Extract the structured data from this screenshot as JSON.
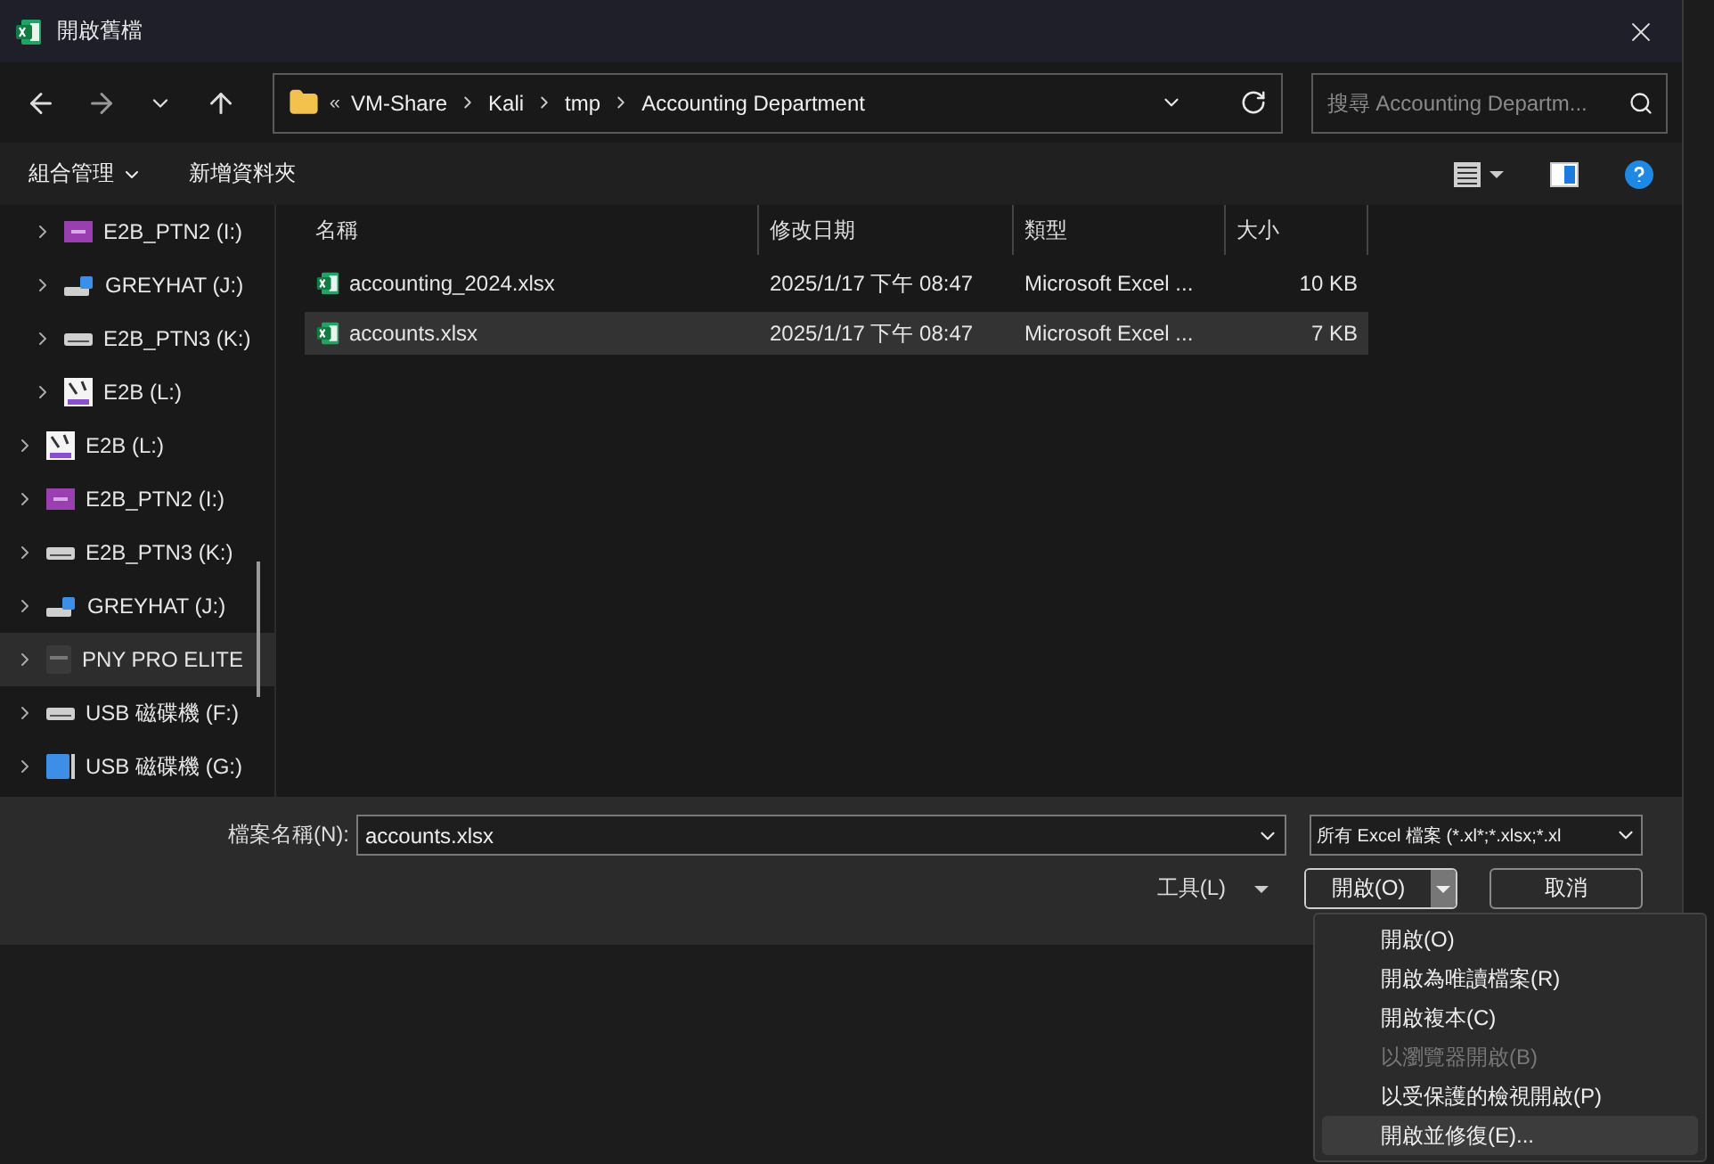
{
  "window": {
    "title": "開啟舊檔"
  },
  "address": {
    "overflow": "«",
    "crumbs": [
      "VM-Share",
      "Kali",
      "tmp",
      "Accounting Department"
    ]
  },
  "search": {
    "placeholder": "搜尋 Accounting Departm..."
  },
  "commands": {
    "organize": "組合管理",
    "new_folder": "新增資料夾"
  },
  "sidebar": {
    "child_items": [
      {
        "label": "E2B_PTN2 (I:)",
        "kind": "badge",
        "selected": false
      },
      {
        "label": "GREYHAT (J:)",
        "kind": "network",
        "selected": false
      },
      {
        "label": "E2B_PTN3 (K:)",
        "kind": "disk",
        "selected": false
      },
      {
        "label": "E2B (L:)",
        "kind": "tool",
        "selected": false
      }
    ],
    "items": [
      {
        "label": "E2B (L:)",
        "kind": "tool",
        "selected": false
      },
      {
        "label": "E2B_PTN2 (I:)",
        "kind": "badge",
        "selected": false
      },
      {
        "label": "E2B_PTN3 (K:)",
        "kind": "disk",
        "selected": false
      },
      {
        "label": "GREYHAT (J:)",
        "kind": "network",
        "selected": false
      },
      {
        "label": "PNY PRO ELITE",
        "kind": "pny",
        "selected": true
      },
      {
        "label": "USB 磁碟機 (F:)",
        "kind": "disk",
        "selected": false
      },
      {
        "label": "USB 磁碟機 (G:)",
        "kind": "usb",
        "selected": false
      }
    ]
  },
  "table": {
    "columns": [
      "名稱",
      "修改日期",
      "類型",
      "大小"
    ],
    "rows": [
      {
        "name": "accounting_2024.xlsx",
        "modified": "2025/1/17 下午 08:47",
        "type": "Microsoft Excel ...",
        "size": "10 KB",
        "selected": false
      },
      {
        "name": "accounts.xlsx",
        "modified": "2025/1/17 下午 08:47",
        "type": "Microsoft Excel ...",
        "size": "7 KB",
        "selected": true
      }
    ]
  },
  "footer": {
    "filename_label": "檔案名稱(N):",
    "filename": "accounts.xlsx",
    "filter": "所有 Excel 檔案 (*.xl*;*.xlsx;*.xl",
    "tools": "工具(L)",
    "open": "開啟(O)",
    "cancel": "取消"
  },
  "open_menu": {
    "items": [
      {
        "label": "開啟(O)",
        "disabled": false,
        "selected": false
      },
      {
        "label": "開啟為唯讀檔案(R)",
        "disabled": false,
        "selected": false
      },
      {
        "label": "開啟複本(C)",
        "disabled": false,
        "selected": false
      },
      {
        "label": "以瀏覽器開啟(B)",
        "disabled": true,
        "selected": false
      },
      {
        "label": "以受保護的檢視開啟(P)",
        "disabled": false,
        "selected": false
      },
      {
        "label": "開啟並修復(E)...",
        "disabled": false,
        "selected": true
      }
    ]
  }
}
